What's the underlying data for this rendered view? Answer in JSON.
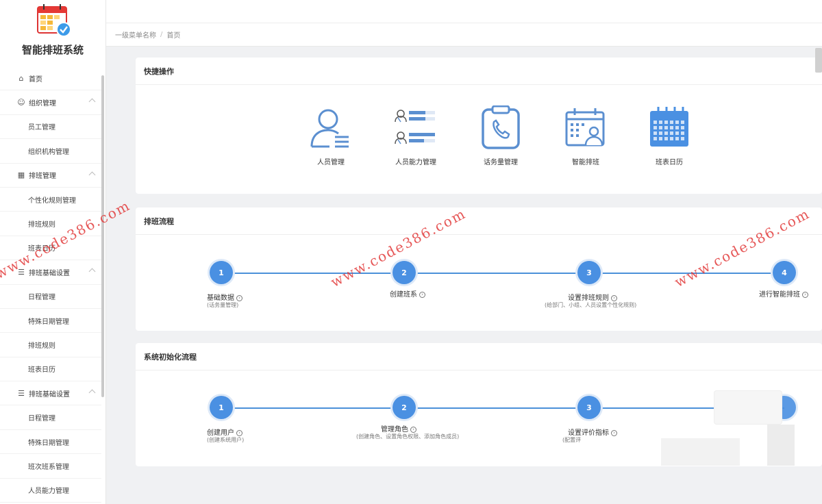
{
  "app": {
    "title": "智能排班系统"
  },
  "breadcrumb": {
    "parent": "一级菜单名称",
    "separator": "/",
    "current": "首页"
  },
  "sidebar": {
    "items": [
      {
        "label": "首页",
        "level": 1,
        "icon": "home-icon"
      },
      {
        "label": "组织管理",
        "level": 1,
        "icon": "users-icon",
        "expandable": true
      },
      {
        "label": "员工管理",
        "level": 2
      },
      {
        "label": "组织机构管理",
        "level": 2
      },
      {
        "label": "排班管理",
        "level": 1,
        "icon": "calendar-icon",
        "expandable": true
      },
      {
        "label": "个性化规则管理",
        "level": 2
      },
      {
        "label": "排班规则",
        "level": 2
      },
      {
        "label": "班表日历",
        "level": 2
      },
      {
        "label": "排班基础设置",
        "level": 1,
        "icon": "list-icon",
        "expandable": true
      },
      {
        "label": "日程管理",
        "level": 2
      },
      {
        "label": "特殊日期管理",
        "level": 2
      },
      {
        "label": "排班规则",
        "level": 2
      },
      {
        "label": "班表日历",
        "level": 2
      },
      {
        "label": "排班基础设置",
        "level": 1,
        "icon": "list-icon",
        "expandable": true
      },
      {
        "label": "日程管理",
        "level": 2
      },
      {
        "label": "特殊日期管理",
        "level": 2
      },
      {
        "label": "班次班系管理",
        "level": 2
      },
      {
        "label": "人员能力管理",
        "level": 2
      }
    ]
  },
  "quick_actions": {
    "title": "快捷操作",
    "items": [
      {
        "label": "人员管理",
        "icon": "person-list-icon"
      },
      {
        "label": "人员能力管理",
        "icon": "people-skills-icon"
      },
      {
        "label": "话务量管理",
        "icon": "phone-clipboard-icon"
      },
      {
        "label": "智能排班",
        "icon": "calendar-person-icon"
      },
      {
        "label": "班表日历",
        "icon": "calendar-grid-icon"
      }
    ]
  },
  "schedule_flow": {
    "title": "排班流程",
    "steps": [
      {
        "num": "1",
        "label": "基础数据",
        "sub": "(话务量管理)"
      },
      {
        "num": "2",
        "label": "创建班系",
        "sub": ""
      },
      {
        "num": "3",
        "label": "设置排班规则",
        "sub": "(给部门、小组、人员设置个性化规则)"
      },
      {
        "num": "4",
        "label": "进行智能排班",
        "sub": ""
      }
    ]
  },
  "init_flow": {
    "title": "系统初始化流程",
    "steps": [
      {
        "num": "1",
        "label": "创建用户",
        "sub": "(创建系统用户)"
      },
      {
        "num": "2",
        "label": "管理角色",
        "sub": "(创建角色、设置角色权限、添加角色成员)"
      },
      {
        "num": "3",
        "label": "设置评价指标",
        "sub": "(配置评"
      }
    ]
  },
  "watermark": {
    "text": "www.code386.com"
  },
  "colors": {
    "accent": "#4a90e2",
    "icon": "#5b8fd0",
    "watermark": "#e23a3a"
  }
}
